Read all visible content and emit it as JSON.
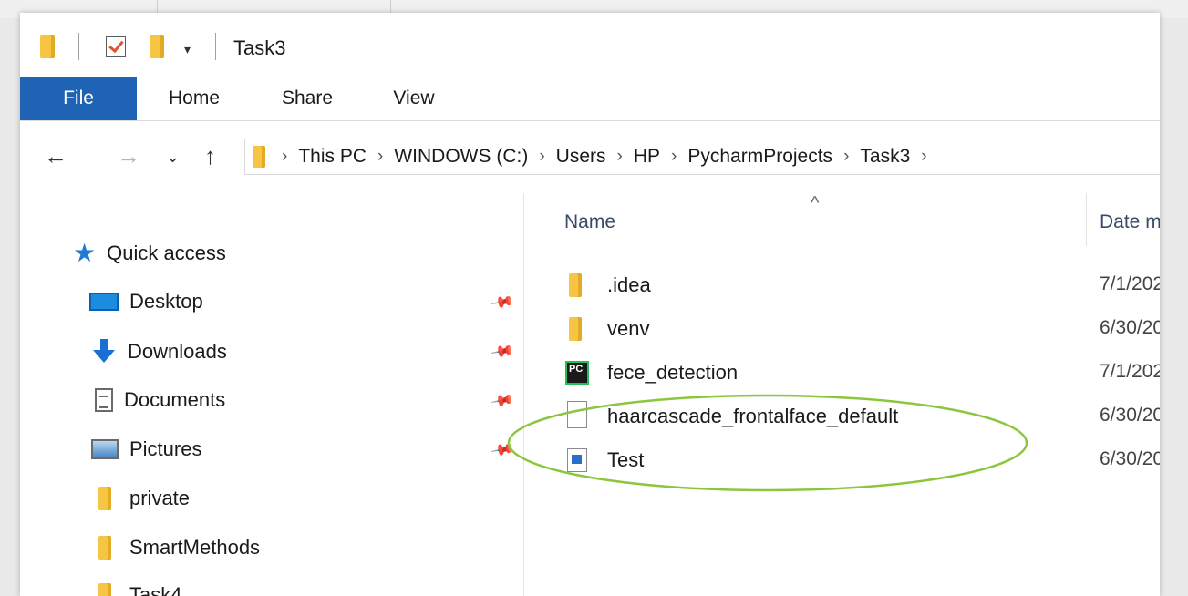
{
  "window": {
    "title": "Task3"
  },
  "ribbon": {
    "tabs": [
      {
        "label": "File"
      },
      {
        "label": "Home"
      },
      {
        "label": "Share"
      },
      {
        "label": "View"
      }
    ]
  },
  "address": {
    "crumbs": [
      "This PC",
      "WINDOWS (C:)",
      "Users",
      "HP",
      "PycharmProjects",
      "Task3"
    ]
  },
  "sidebar": {
    "items": [
      {
        "label": "Quick access",
        "icon": "star-icon"
      },
      {
        "label": "Desktop",
        "icon": "desktop-icon",
        "pinned": true
      },
      {
        "label": "Downloads",
        "icon": "download-icon",
        "pinned": true
      },
      {
        "label": "Documents",
        "icon": "documents-icon",
        "pinned": true
      },
      {
        "label": "Pictures",
        "icon": "pictures-icon",
        "pinned": true
      },
      {
        "label": "private",
        "icon": "folder-icon"
      },
      {
        "label": "SmartMethods",
        "icon": "folder-icon"
      },
      {
        "label": "Task4",
        "icon": "folder-icon"
      }
    ]
  },
  "filelist": {
    "columns": {
      "name": "Name",
      "date": "Date m"
    },
    "rows": [
      {
        "name": ".idea",
        "date": "7/1/202",
        "icon": "folder-icon"
      },
      {
        "name": "venv",
        "date": "6/30/20",
        "icon": "folder-icon"
      },
      {
        "name": "fece_detection",
        "date": "7/1/202",
        "icon": "pycharm-file-icon"
      },
      {
        "name": "haarcascade_frontalface_default",
        "date": "6/30/20",
        "icon": "generic-file-icon"
      },
      {
        "name": "Test",
        "date": "6/30/20",
        "icon": "image-file-icon"
      }
    ]
  },
  "annotation": {
    "color": "#8cc63f"
  },
  "colors": {
    "file_tab": "#1f63b5",
    "folder": "#f6c543"
  }
}
